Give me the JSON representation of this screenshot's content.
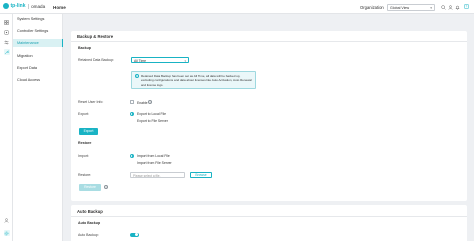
{
  "app": {
    "logo_brand": "tp-link",
    "logo_product": "omada",
    "page_title": "Home"
  },
  "header": {
    "org_label": "Organization",
    "org_value": "Global View"
  },
  "rail": {
    "icons": [
      "dashboard-icon",
      "devices-icon",
      "settings-icon",
      "tools-icon",
      "user-icon",
      "gear-icon"
    ]
  },
  "sidebar": {
    "items": [
      {
        "label": "System Settings"
      },
      {
        "label": "Controller Settings"
      },
      {
        "label": "Maintenance"
      },
      {
        "label": "Migration"
      },
      {
        "label": "Export Data"
      },
      {
        "label": "Cloud Access"
      }
    ]
  },
  "backup_restore": {
    "title": "Backup & Restore",
    "backup_heading": "Backup",
    "retained_label": "Retained Data Backup:",
    "retained_value": "All Time",
    "info_text": "Retained Data Backup has been set as All Time, all data will be backed up, excluding configurations and data about licenses like Auto Activation, Auto Renewal and license logs.",
    "reset_label": "Reset User Info:",
    "reset_option": "Enable",
    "export_label": "Export:",
    "export_opt1": "Export to Local File",
    "export_opt2": "Export to File Server",
    "export_button": "Export",
    "restore_heading": "Restore",
    "import_label": "Import:",
    "import_opt1": "Import from Local File",
    "import_opt2": "Import from File Server",
    "restore_label": "Restore:",
    "file_placeholder": "Please select a file.",
    "browse_button": "Browse",
    "restore_button": "Restore"
  },
  "auto_backup": {
    "title": "Auto Backup",
    "heading": "Auto Backup",
    "label": "Auto Backup:",
    "enabled": true
  }
}
